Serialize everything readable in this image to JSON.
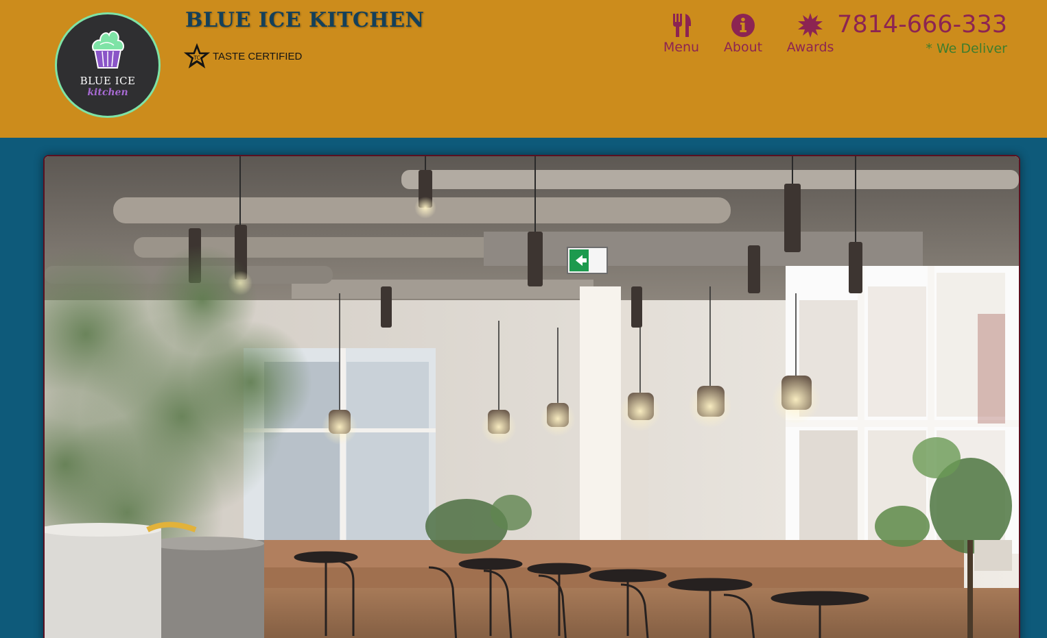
{
  "brand": {
    "name": "BLUE ICE KITCHEN",
    "certification": "TASTE CERTIFIED",
    "logo": {
      "line1": "BLUE ICE",
      "line2": "kitchen"
    }
  },
  "nav": {
    "items": [
      {
        "label": "Menu",
        "icon": "fork-knife-icon"
      },
      {
        "label": "About",
        "icon": "info-circle-icon"
      },
      {
        "label": "Awards",
        "icon": "starburst-icon"
      }
    ]
  },
  "contact": {
    "phone": "7814-666-333",
    "delivery_note": "* We Deliver"
  },
  "hero": {
    "image": "restaurant-interior-photo"
  },
  "colors": {
    "header_bg": "#cc8c1c",
    "page_bg": "#0e5a7a",
    "accent": "#8c2452",
    "title": "#14405a",
    "delivery": "#3e7d2d",
    "logo_ring": "#7ee3a6"
  }
}
